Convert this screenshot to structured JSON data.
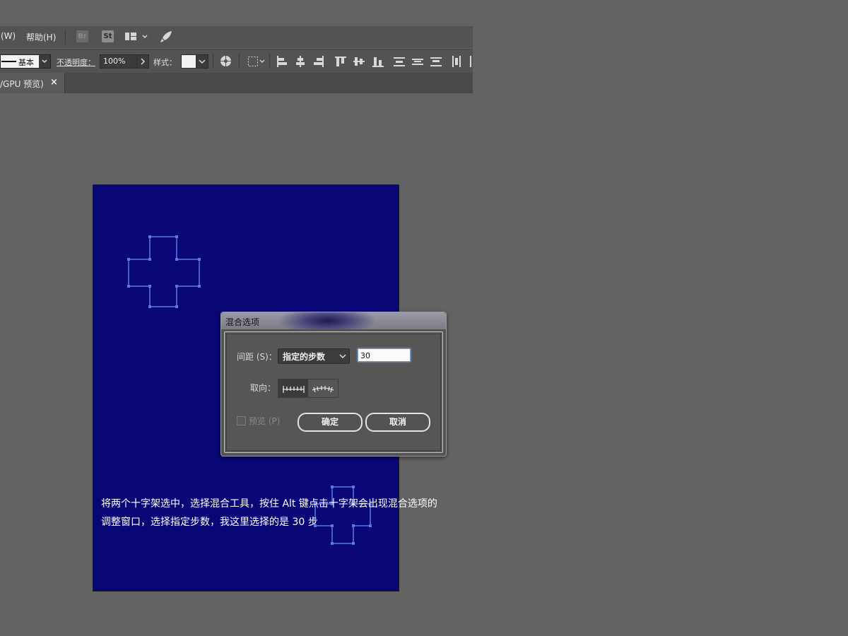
{
  "menubar": {
    "window_menu": "(W)",
    "help_menu": "帮助(H)",
    "bridge_label": "Br",
    "stock_label": "St"
  },
  "controlbar": {
    "stroke_profile": "基本",
    "opacity_label": "不透明度：",
    "opacity_value": "100%",
    "style_label": "样式："
  },
  "tab": {
    "title": "/GPU 预览)",
    "close": "×"
  },
  "dialog": {
    "title": "混合选项",
    "spacing_label": "间距 (S)：",
    "spacing_value": "指定的步数",
    "steps_value": "30",
    "orientation_label": "取向：",
    "preview_label": "预览 (P)",
    "ok_label": "确定",
    "cancel_label": "取消"
  },
  "caption": {
    "line1": "将两个十字架选中，选择混合工具，按住 Alt 键点击十字架会出现混合选项的",
    "line2": "调整窗口，选择指定步数，我这里选择的是 30 步"
  },
  "colors": {
    "app_bg": "#636363",
    "panel": "#535353",
    "artboard": "#090776",
    "selection": "#5b79e6"
  },
  "icons": [
    "bridge-icon",
    "stock-icon",
    "workspace-icon",
    "rocket-icon",
    "recolor-icon",
    "transform-icon",
    "align-icons",
    "orient-page-icon",
    "orient-path-icon",
    "checkbox-icon",
    "close-icon"
  ]
}
